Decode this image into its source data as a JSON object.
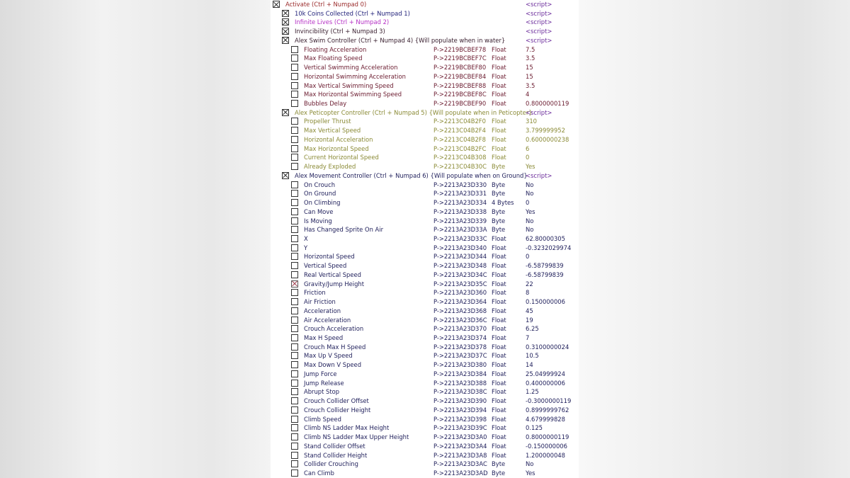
{
  "colors": {
    "activate": "#9a2a2a",
    "coins": "#22227a",
    "lives": "#b530c5",
    "invinc": "#3a2030",
    "swim": "#3a2030",
    "swimChild": "#6a1a2e",
    "peti": "#8a8a35",
    "move": "#1e1e5a",
    "script": "#6a2a9a"
  },
  "rows": [
    {
      "level": 0,
      "checked": true,
      "desc": "Activate (Ctrl + Numpad 0)",
      "addr": "",
      "type": "",
      "value": "<script>",
      "color": "activate"
    },
    {
      "level": 1,
      "checked": true,
      "desc": "10k Coins Collected (Ctrl + Numpad 1)",
      "addr": "",
      "type": "",
      "value": "<script>",
      "color": "coins"
    },
    {
      "level": 1,
      "checked": true,
      "desc": "Infinite Lives (Ctrl + Numpad 2)",
      "addr": "",
      "type": "",
      "value": "<script>",
      "color": "lives"
    },
    {
      "level": 1,
      "checked": true,
      "desc": "Invincibility (Ctrl + Numpad 3)",
      "addr": "",
      "type": "",
      "value": "<script>",
      "color": "invinc"
    },
    {
      "level": 1,
      "checked": true,
      "desc": "Alex Swim Controller (Ctrl + Numpad 4) {Will populate when in water}",
      "addr": "",
      "type": "",
      "value": "<script>",
      "color": "swim"
    },
    {
      "level": 2,
      "checked": false,
      "desc": "Floating Acceleration",
      "addr": "P->2219BCBEF78",
      "type": "Float",
      "value": "7.5",
      "color": "swimChild"
    },
    {
      "level": 2,
      "checked": false,
      "desc": "Max Floating Speed",
      "addr": "P->2219BCBEF7C",
      "type": "Float",
      "value": "3.5",
      "color": "swimChild"
    },
    {
      "level": 2,
      "checked": false,
      "desc": "Vertical Swimming Acceleration",
      "addr": "P->2219BCBEF80",
      "type": "Float",
      "value": "15",
      "color": "swimChild"
    },
    {
      "level": 2,
      "checked": false,
      "desc": "Horizontal Swimming Acceleration",
      "addr": "P->2219BCBEF84",
      "type": "Float",
      "value": "15",
      "color": "swimChild"
    },
    {
      "level": 2,
      "checked": false,
      "desc": "Max Vertical Swimming Speed",
      "addr": "P->2219BCBEF88",
      "type": "Float",
      "value": "3.5",
      "color": "swimChild"
    },
    {
      "level": 2,
      "checked": false,
      "desc": "Max Horizontal Swimming Speed",
      "addr": "P->2219BCBEF8C",
      "type": "Float",
      "value": "4",
      "color": "swimChild"
    },
    {
      "level": 2,
      "checked": false,
      "desc": "Bubbles Delay",
      "addr": "P->2219BCBEF90",
      "type": "Float",
      "value": "0.8000000119",
      "color": "swimChild"
    },
    {
      "level": 1,
      "checked": true,
      "desc": "Alex Peticopter Controller (Ctrl + Numpad 5) {Will populate when in Peticopter}",
      "addr": "",
      "type": "",
      "value": "<script>",
      "color": "peti"
    },
    {
      "level": 2,
      "checked": false,
      "desc": "Propeller Thrust",
      "addr": "P->2213C04B2F0",
      "type": "Float",
      "value": "310",
      "color": "peti"
    },
    {
      "level": 2,
      "checked": false,
      "desc": "Max Vertical Speed",
      "addr": "P->2213C04B2F4",
      "type": "Float",
      "value": "3.799999952",
      "color": "peti"
    },
    {
      "level": 2,
      "checked": false,
      "desc": "Horizontal Acceleration",
      "addr": "P->2213C04B2F8",
      "type": "Float",
      "value": "0.6000000238",
      "color": "peti"
    },
    {
      "level": 2,
      "checked": false,
      "desc": "Max Horizontal Speed",
      "addr": "P->2213C04B2FC",
      "type": "Float",
      "value": "6",
      "color": "peti"
    },
    {
      "level": 2,
      "checked": false,
      "desc": "Current Horizontal Speed",
      "addr": "P->2213C04B308",
      "type": "Float",
      "value": "0",
      "color": "peti"
    },
    {
      "level": 2,
      "checked": false,
      "desc": "Already Exploded",
      "addr": "P->2213C04B30C",
      "type": "Byte",
      "value": "Yes",
      "color": "peti"
    },
    {
      "level": 1,
      "checked": true,
      "desc": "Alex Movement Controller (Ctrl + Numpad 6) {Will populate when on Ground}",
      "addr": "",
      "type": "",
      "value": "<script>",
      "color": "move"
    },
    {
      "level": 2,
      "checked": false,
      "desc": "On Crouch",
      "addr": "P->2213A23D330",
      "type": "Byte",
      "value": "No",
      "color": "move"
    },
    {
      "level": 2,
      "checked": false,
      "desc": "On Ground",
      "addr": "P->2213A23D331",
      "type": "Byte",
      "value": "No",
      "color": "move"
    },
    {
      "level": 2,
      "checked": false,
      "desc": "On Climbing",
      "addr": "P->2213A23D334",
      "type": "4 Bytes",
      "value": "0",
      "color": "move"
    },
    {
      "level": 2,
      "checked": false,
      "desc": "Can Move",
      "addr": "P->2213A23D338",
      "type": "Byte",
      "value": "Yes",
      "color": "move"
    },
    {
      "level": 2,
      "checked": false,
      "desc": "Is Moving",
      "addr": "P->2213A23D339",
      "type": "Byte",
      "value": "No",
      "color": "move"
    },
    {
      "level": 2,
      "checked": false,
      "desc": "Has Changed Sprite On Air",
      "addr": "P->2213A23D33A",
      "type": "Byte",
      "value": "No",
      "color": "move"
    },
    {
      "level": 2,
      "checked": false,
      "desc": "X",
      "addr": "P->2213A23D33C",
      "type": "Float",
      "value": "62.80000305",
      "color": "move"
    },
    {
      "level": 2,
      "checked": false,
      "desc": "Y",
      "addr": "P->2213A23D340",
      "type": "Float",
      "value": "-0.3232029974",
      "color": "move"
    },
    {
      "level": 2,
      "checked": false,
      "desc": "Horizontal Speed",
      "addr": "P->2213A23D344",
      "type": "Float",
      "value": "0",
      "color": "move"
    },
    {
      "level": 2,
      "checked": false,
      "desc": "Vertical Speed",
      "addr": "P->2213A23D348",
      "type": "Float",
      "value": "-6.58799839",
      "color": "move"
    },
    {
      "level": 2,
      "checked": false,
      "desc": "Real Vertical Speed",
      "addr": "P->2213A23D34C",
      "type": "Float",
      "value": "-6.58799839",
      "color": "move"
    },
    {
      "level": 2,
      "checked": true,
      "desc": "Gravity/Jump Height",
      "addr": "P->2213A23D35C",
      "type": "Float",
      "value": "22",
      "color": "move"
    },
    {
      "level": 2,
      "checked": false,
      "desc": "Friction",
      "addr": "P->2213A23D360",
      "type": "Float",
      "value": "8",
      "color": "move"
    },
    {
      "level": 2,
      "checked": false,
      "desc": "Air Friction",
      "addr": "P->2213A23D364",
      "type": "Float",
      "value": "0.150000006",
      "color": "move"
    },
    {
      "level": 2,
      "checked": false,
      "desc": "Acceleration",
      "addr": "P->2213A23D368",
      "type": "Float",
      "value": "45",
      "color": "move"
    },
    {
      "level": 2,
      "checked": false,
      "desc": "Air Acceleration",
      "addr": "P->2213A23D36C",
      "type": "Float",
      "value": "19",
      "color": "move"
    },
    {
      "level": 2,
      "checked": false,
      "desc": "Crouch Acceleration",
      "addr": "P->2213A23D370",
      "type": "Float",
      "value": "6.25",
      "color": "move"
    },
    {
      "level": 2,
      "checked": false,
      "desc": "Max H Speed",
      "addr": "P->2213A23D374",
      "type": "Float",
      "value": "7",
      "color": "move"
    },
    {
      "level": 2,
      "checked": false,
      "desc": "Crouch Max H Speed",
      "addr": "P->2213A23D378",
      "type": "Float",
      "value": "0.3100000024",
      "color": "move"
    },
    {
      "level": 2,
      "checked": false,
      "desc": "Max Up V Speed",
      "addr": "P->2213A23D37C",
      "type": "Float",
      "value": "10.5",
      "color": "move"
    },
    {
      "level": 2,
      "checked": false,
      "desc": "Max Down V Speed",
      "addr": "P->2213A23D380",
      "type": "Float",
      "value": "14",
      "color": "move"
    },
    {
      "level": 2,
      "checked": false,
      "desc": "Jump Force",
      "addr": "P->2213A23D384",
      "type": "Float",
      "value": "25.04999924",
      "color": "move"
    },
    {
      "level": 2,
      "checked": false,
      "desc": "Jump Release",
      "addr": "P->2213A23D388",
      "type": "Float",
      "value": "0.400000006",
      "color": "move"
    },
    {
      "level": 2,
      "checked": false,
      "desc": "Abrupt Stop",
      "addr": "P->2213A23D38C",
      "type": "Float",
      "value": "1.25",
      "color": "move"
    },
    {
      "level": 2,
      "checked": false,
      "desc": "Crouch Collider Offset",
      "addr": "P->2213A23D390",
      "type": "Float",
      "value": "-0.3000000119",
      "color": "move"
    },
    {
      "level": 2,
      "checked": false,
      "desc": "Crouch Collider Height",
      "addr": "P->2213A23D394",
      "type": "Float",
      "value": "0.8999999762",
      "color": "move"
    },
    {
      "level": 2,
      "checked": false,
      "desc": "Climb Speed",
      "addr": "P->2213A23D398",
      "type": "Float",
      "value": "4.679999828",
      "color": "move"
    },
    {
      "level": 2,
      "checked": false,
      "desc": "Climb NS Ladder Max Height",
      "addr": "P->2213A23D39C",
      "type": "Float",
      "value": "0.125",
      "color": "move"
    },
    {
      "level": 2,
      "checked": false,
      "desc": "Climb NS Ladder Max Upper Height",
      "addr": "P->2213A23D3A0",
      "type": "Float",
      "value": "0.8000000119",
      "color": "move"
    },
    {
      "level": 2,
      "checked": false,
      "desc": "Stand Collider Offset",
      "addr": "P->2213A23D3A4",
      "type": "Float",
      "value": "-0.150000006",
      "color": "move"
    },
    {
      "level": 2,
      "checked": false,
      "desc": "Stand Collider Height",
      "addr": "P->2213A23D3A8",
      "type": "Float",
      "value": "1.200000048",
      "color": "move"
    },
    {
      "level": 2,
      "checked": false,
      "desc": "Collider Crouching",
      "addr": "P->2213A23D3AC",
      "type": "Byte",
      "value": "No",
      "color": "move"
    },
    {
      "level": 2,
      "checked": false,
      "desc": "Can Climb",
      "addr": "P->2213A23D3AD",
      "type": "Byte",
      "value": "Yes",
      "color": "move"
    }
  ]
}
